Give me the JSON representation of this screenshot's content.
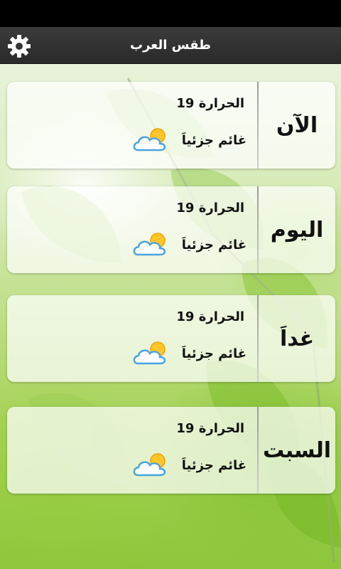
{
  "app": {
    "title": "طقس العرب",
    "settings_icon": "gear-icon"
  },
  "colors": {
    "app_bar": "#333333",
    "leaf_green": "#8cc63a",
    "card_bg": "#ffffff",
    "text": "#111111"
  },
  "forecast": [
    {
      "day": "الآن",
      "temperature": "الحرارة 19",
      "condition": "غائم جزئياَ",
      "icon": "partly-cloudy-icon"
    },
    {
      "day": "اليوم",
      "temperature": "الحرارة 19",
      "condition": "غائم جزئياَ",
      "icon": "partly-cloudy-icon"
    },
    {
      "day": "غداَ",
      "temperature": "الحرارة 19",
      "condition": "غائم جزئياَ",
      "icon": "partly-cloudy-icon"
    },
    {
      "day": "السبت",
      "temperature": "الحرارة 19",
      "condition": "غائم جزئياَ",
      "icon": "partly-cloudy-icon"
    }
  ]
}
